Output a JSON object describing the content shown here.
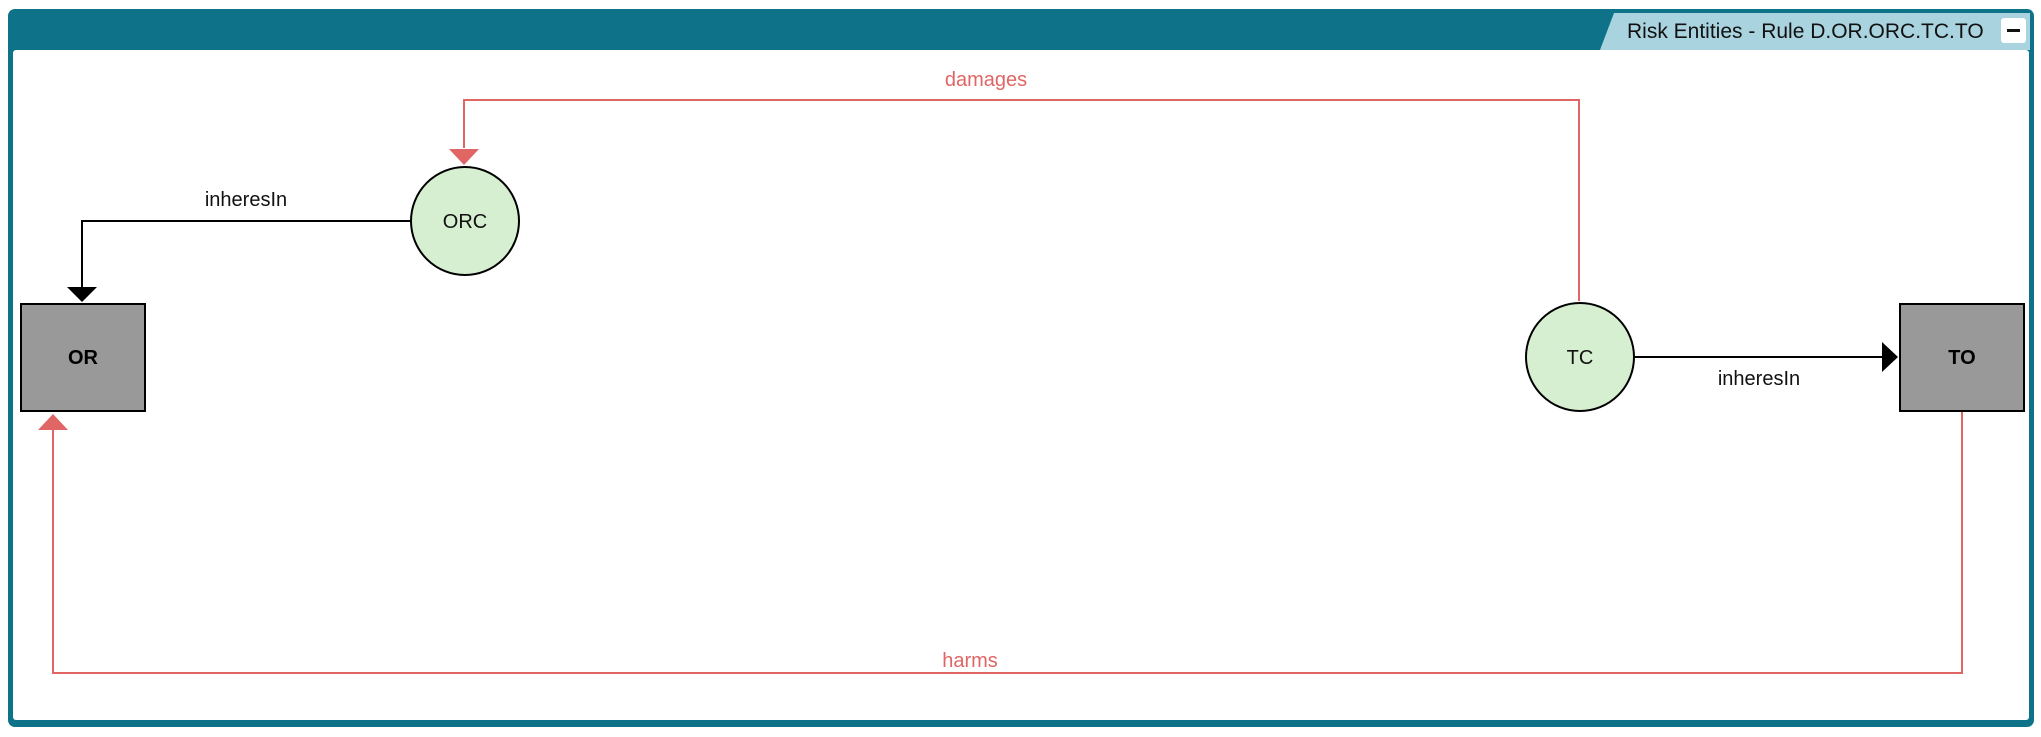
{
  "panel": {
    "title": "Risk Entities - Rule D.OR.ORC.TC.TO",
    "collapse_icon": "minus-icon"
  },
  "colors": {
    "frame": "#0e7388",
    "tab": "#a9d3df",
    "relation_red": "#e06666",
    "relation_black": "#000000",
    "circle_fill": "#d5efd0",
    "box_fill": "#999999"
  },
  "nodes": {
    "orc": {
      "label": "ORC",
      "shape": "circle"
    },
    "tc": {
      "label": "TC",
      "shape": "circle"
    },
    "or": {
      "label": "OR",
      "shape": "box"
    },
    "to": {
      "label": "TO",
      "shape": "box"
    }
  },
  "edges": {
    "damages": {
      "label": "damages",
      "from": "TC",
      "to": "ORC",
      "color": "red"
    },
    "inheres_orc": {
      "label": "inheresIn",
      "from": "ORC",
      "to": "OR",
      "color": "black"
    },
    "inheres_tc": {
      "label": "inheresIn",
      "from": "TC",
      "to": "TO",
      "color": "black"
    },
    "harms": {
      "label": "harms",
      "from": "TO",
      "to": "OR",
      "color": "red"
    }
  }
}
